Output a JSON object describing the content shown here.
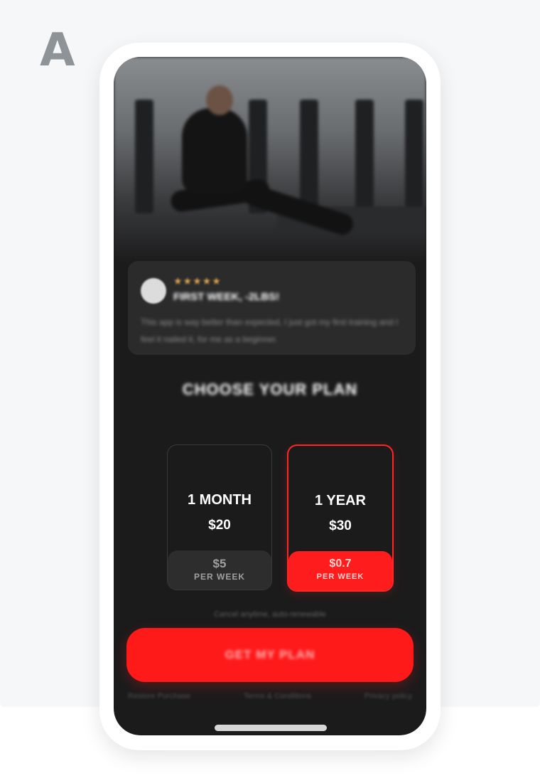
{
  "variant_label": "A",
  "review": {
    "rating": 5,
    "stars": "★★★★★",
    "title": "FIRST WEEK, -2LBS!",
    "body": "This app is way better than expected, I just got my first training and I feel it nailed it, for me as a beginner."
  },
  "section_title": "CHOOSE YOUR PLAN",
  "plans": [
    {
      "duration": "1 MONTH",
      "price": "$20",
      "weekly": "$5",
      "per": "PER WEEK",
      "selected": false
    },
    {
      "duration": "1 YEAR",
      "price": "$30",
      "weekly": "$0.7",
      "per": "PER WEEK",
      "selected": true
    }
  ],
  "cancel_note": "Cancel anytime, auto-renewable",
  "cta_label": "GET MY PLAN",
  "footer_links": [
    "Restore Purchase",
    "Terms & Conditions",
    "Privacy policy"
  ],
  "colors": {
    "accent": "#ff1a1a",
    "screen_bg": "#1b1b1c",
    "card_bg": "#2b2b2c",
    "star": "#d9a24a"
  }
}
